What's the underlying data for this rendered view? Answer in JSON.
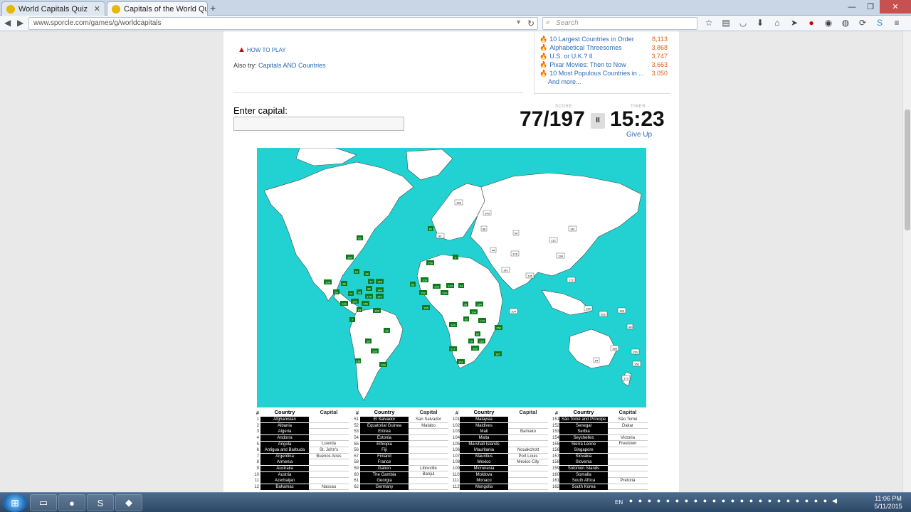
{
  "browser": {
    "tabs": [
      {
        "title": "World Capitals Quiz",
        "active": false
      },
      {
        "title": "Capitals of the World Quiz",
        "active": true
      }
    ],
    "url": "www.sporcle.com/games/g/worldcapitals",
    "search_placeholder": "Search",
    "icons": [
      "star-icon",
      "clipboard-icon",
      "pocket-icon",
      "download-icon",
      "home-icon",
      "send-icon",
      "adblock-icon",
      "reader-icon",
      "chat-icon",
      "sync-icon",
      "skype-icon",
      "menu-icon"
    ]
  },
  "page": {
    "how_to_play": "HOW TO PLAY",
    "also_try_prefix": "Also try:",
    "also_try_link": "Capitals AND Countries",
    "enter_label": "Enter capital:",
    "score_label": "SCORE",
    "score": "77/197",
    "pause": "II",
    "timer_label": "TIMER",
    "timer": "15:23",
    "give_up": "Give Up"
  },
  "popular": {
    "items": [
      {
        "label": "10 Largest Countries in Order",
        "count": "8,113"
      },
      {
        "label": "Alphabetical Threesomes",
        "count": "3,868"
      },
      {
        "label": "U.S. or U.K.? II",
        "count": "3,747"
      },
      {
        "label": "Pixar Movies: Then to Now",
        "count": "3,663"
      },
      {
        "label": "10 Most Populous Countries in ...",
        "count": "3,050"
      }
    ],
    "more": "And more..."
  },
  "table": {
    "headers": {
      "num": "#",
      "country": "Country",
      "capital": "Capital"
    },
    "columns": [
      [
        [
          "1",
          "Afghanistan",
          ""
        ],
        [
          "2",
          "Albania",
          ""
        ],
        [
          "3",
          "Algeria",
          ""
        ],
        [
          "4",
          "Andorra",
          ""
        ],
        [
          "5",
          "Angola",
          "Luanda"
        ],
        [
          "6",
          "Antigua and Barbuda",
          "St. John's"
        ],
        [
          "7",
          "Argentina",
          "Buenos Aires"
        ],
        [
          "8",
          "Armenia",
          ""
        ],
        [
          "9",
          "Australia",
          ""
        ],
        [
          "10",
          "Austria",
          ""
        ],
        [
          "11",
          "Azerbaijan",
          ""
        ],
        [
          "12",
          "Bahamas",
          "Nassau"
        ]
      ],
      [
        [
          "51",
          "El Salvador",
          "San Salvador"
        ],
        [
          "52",
          "Equatorial Guinea",
          "Malabo"
        ],
        [
          "53",
          "Eritrea",
          ""
        ],
        [
          "54",
          "Estonia",
          ""
        ],
        [
          "55",
          "Ethiopia",
          ""
        ],
        [
          "56",
          "Fiji",
          ""
        ],
        [
          "57",
          "Finland",
          ""
        ],
        [
          "58",
          "France",
          ""
        ],
        [
          "59",
          "Gabon",
          "Libreville"
        ],
        [
          "60",
          "The Gambia",
          "Banjul"
        ],
        [
          "61",
          "Georgia",
          ""
        ],
        [
          "62",
          "Germany",
          ""
        ]
      ],
      [
        [
          "101",
          "Malaysia",
          ""
        ],
        [
          "102",
          "Maldives",
          ""
        ],
        [
          "103",
          "Mali",
          "Bamako"
        ],
        [
          "104",
          "Malta",
          ""
        ],
        [
          "105",
          "Marshall Islands",
          ""
        ],
        [
          "106",
          "Mauritania",
          "Nouakchott"
        ],
        [
          "107",
          "Mauritius",
          "Port Louis"
        ],
        [
          "108",
          "Mexico",
          "Mexico City"
        ],
        [
          "109",
          "Micronesia",
          ""
        ],
        [
          "110",
          "Moldova",
          ""
        ],
        [
          "111",
          "Monaco",
          ""
        ],
        [
          "112",
          "Mongolia",
          ""
        ]
      ],
      [
        [
          "151",
          "São Tomé and Príncipe",
          "São Tomé"
        ],
        [
          "152",
          "Senegal",
          "Dakar"
        ],
        [
          "153",
          "Serbia",
          ""
        ],
        [
          "154",
          "Seychelles",
          "Victoria"
        ],
        [
          "155",
          "Sierra Leone",
          "Freetown"
        ],
        [
          "156",
          "Singapore",
          ""
        ],
        [
          "157",
          "Slovakia",
          ""
        ],
        [
          "158",
          "Slovenia",
          ""
        ],
        [
          "159",
          "Solomon Islands",
          ""
        ],
        [
          "160",
          "Somalia",
          ""
        ],
        [
          "161",
          "South Africa",
          "Pretoria"
        ],
        [
          "162",
          "South Korea",
          ""
        ]
      ]
    ]
  },
  "map_markers": {
    "found": [
      "63",
      "160",
      "108",
      "12",
      "48",
      "47",
      "145",
      "98",
      "85",
      "140",
      "38",
      "66",
      "71",
      "179",
      "147",
      "122",
      "131",
      "146",
      "165",
      "83",
      "136",
      "7",
      "35",
      "133",
      "189",
      "26",
      "5",
      "52",
      "29",
      "106",
      "152",
      "155",
      "103",
      "124",
      "34",
      "143",
      "85",
      "33",
      "164",
      "184",
      "186",
      "174",
      "140",
      "60",
      "160",
      "117",
      "70",
      "115",
      "187",
      "156",
      "161",
      "1",
      "159",
      "82"
    ],
    "missing": [
      "166",
      "143",
      "86",
      "54",
      "112",
      "134",
      "172",
      "104",
      "135",
      "44",
      "141",
      "150",
      "162",
      "188",
      "180",
      "165",
      "150",
      "166",
      "178",
      "173",
      "64",
      "81",
      "141"
    ]
  },
  "taskbar": {
    "lang": "EN",
    "time": "11:06 PM",
    "date": "5/11/2015"
  },
  "colors": {
    "ocean": "#22d2d2",
    "found_marker": "#0b7a1a",
    "link": "#2a6ab6"
  }
}
